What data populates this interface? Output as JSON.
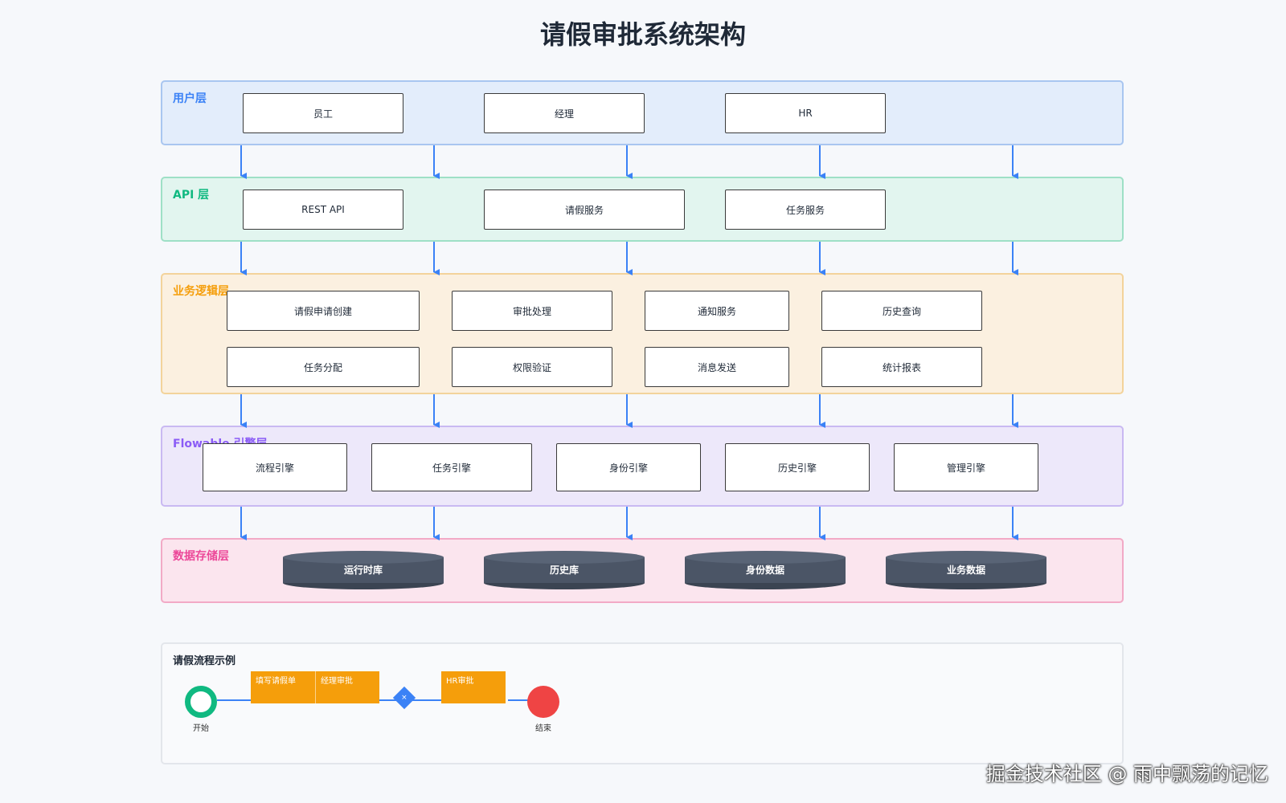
{
  "title": "请假审批系统架构",
  "colors": {
    "user": "#3b82f6",
    "api": "#10b981",
    "business": "#f59e0b",
    "engine": "#8b5cf6",
    "data": "#ec4899",
    "arrow": "#3b82f6"
  },
  "layers": {
    "user": {
      "label": "用户层",
      "nodes": [
        "员工",
        "经理",
        "HR"
      ]
    },
    "api": {
      "label": "API 层",
      "nodes": [
        "REST API",
        "请假服务",
        "任务服务"
      ]
    },
    "business": {
      "label": "业务逻辑层",
      "row1": [
        "请假申请创建",
        "审批处理",
        "通知服务",
        "历史查询"
      ],
      "row2": [
        "任务分配",
        "权限验证",
        "消息发送",
        "统计报表"
      ]
    },
    "engine": {
      "label": "Flowable 引擎层",
      "nodes": [
        "流程引擎",
        "任务引擎",
        "身份引擎",
        "历史引擎",
        "管理引擎"
      ]
    },
    "data": {
      "label": "数据存储层",
      "stores": [
        "运行时库",
        "历史库",
        "身份数据",
        "业务数据"
      ]
    }
  },
  "flow_example": {
    "title": "请假流程示例",
    "start_label": "开始",
    "tasks": [
      "填写请假单",
      "经理审批",
      "HR审批"
    ],
    "gateway_symbol": "×",
    "end_label": "结束",
    "start_color": "#10b981",
    "task_color": "#f59e0b",
    "gateway_color": "#3b82f6",
    "end_color": "#ef4444"
  },
  "watermark": "掘金技术社区 @ 雨中飘荡的记忆"
}
